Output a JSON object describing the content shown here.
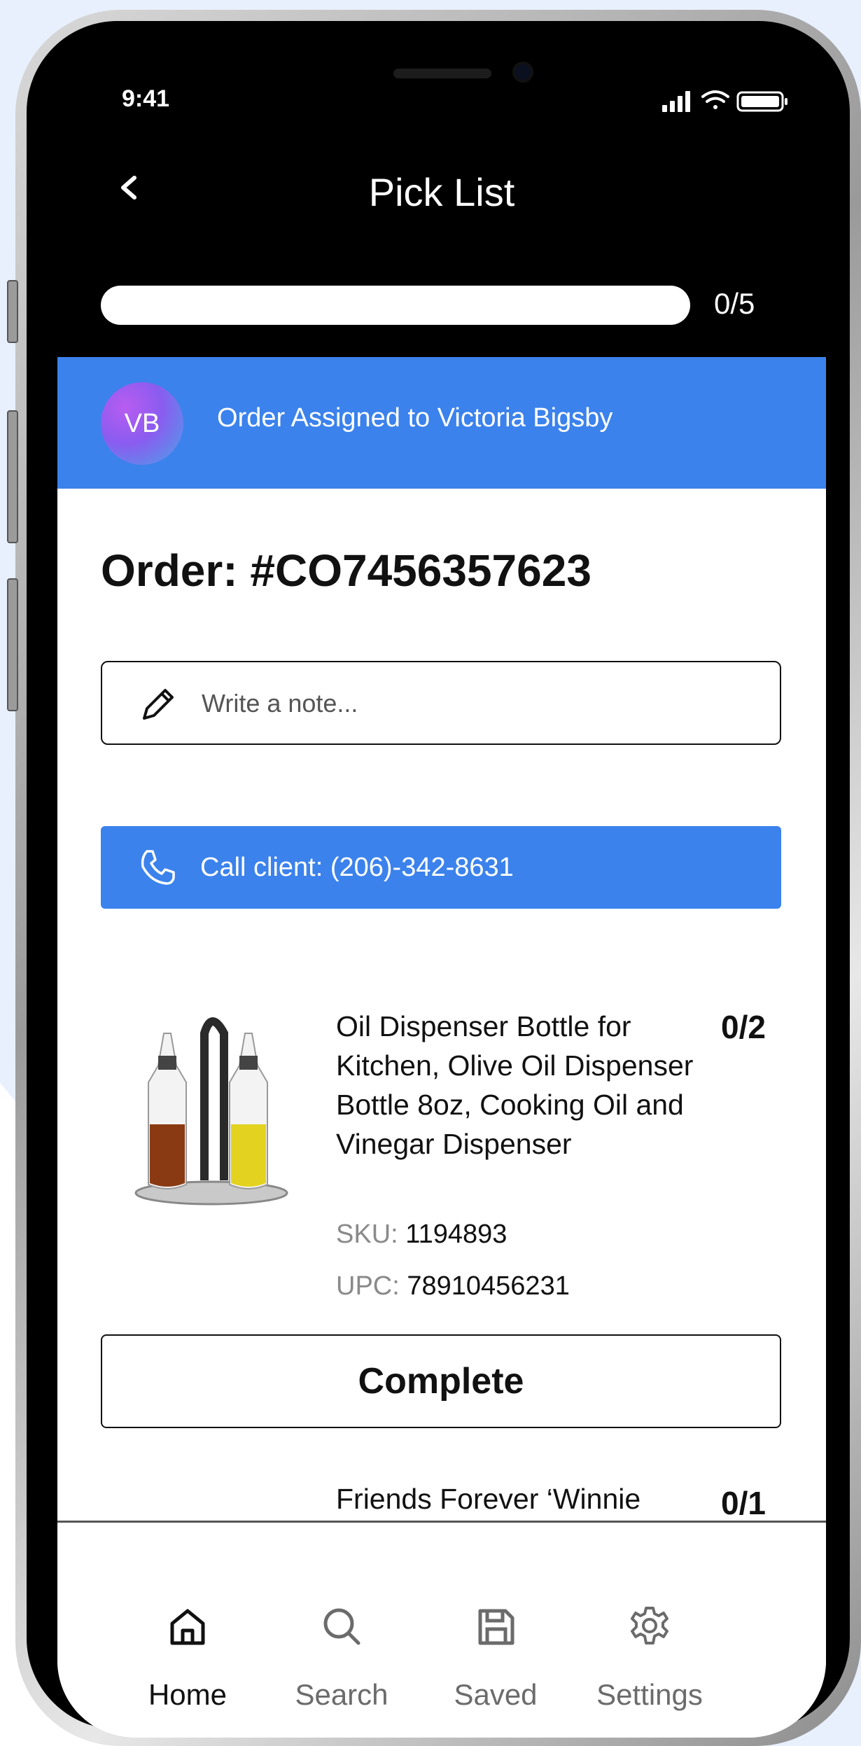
{
  "status_bar": {
    "time": "9:41"
  },
  "header": {
    "back_icon": "chevron-left-icon",
    "title": "Pick List"
  },
  "progress": {
    "completed": 0,
    "total": 5,
    "fraction": 0,
    "label": "0/5"
  },
  "assignment": {
    "avatar_initials": "VB",
    "text": "Order Assigned to Victoria Bigsby"
  },
  "order": {
    "title": "Order: #CO7456357623"
  },
  "note": {
    "placeholder": "Write a note...",
    "icon": "pencil-icon"
  },
  "call": {
    "label": "Call client: (206)-342-8631",
    "icon": "phone-icon"
  },
  "items": [
    {
      "title": "Oil Dispenser Bottle for Kitchen, Olive Oil Dispenser Bottle 8oz, Cooking Oil and Vinegar Dispenser",
      "qty": "0/2",
      "sku_label": "SKU:",
      "sku": "1194893",
      "upc_label": "UPC:",
      "upc": "78910456231",
      "complete_label": "Complete"
    },
    {
      "title": "Friends Forever ‘Winnie",
      "qty": "0/1"
    }
  ],
  "tabbar": {
    "tabs": [
      {
        "label": "Home",
        "icon": "home-icon",
        "active": true
      },
      {
        "label": "Search",
        "icon": "search-icon",
        "active": false
      },
      {
        "label": "Saved",
        "icon": "save-icon",
        "active": false
      },
      {
        "label": "Settings",
        "icon": "gear-icon",
        "active": false
      }
    ]
  },
  "colors": {
    "accent": "#3b82ec",
    "background": "#e8f0fd"
  }
}
